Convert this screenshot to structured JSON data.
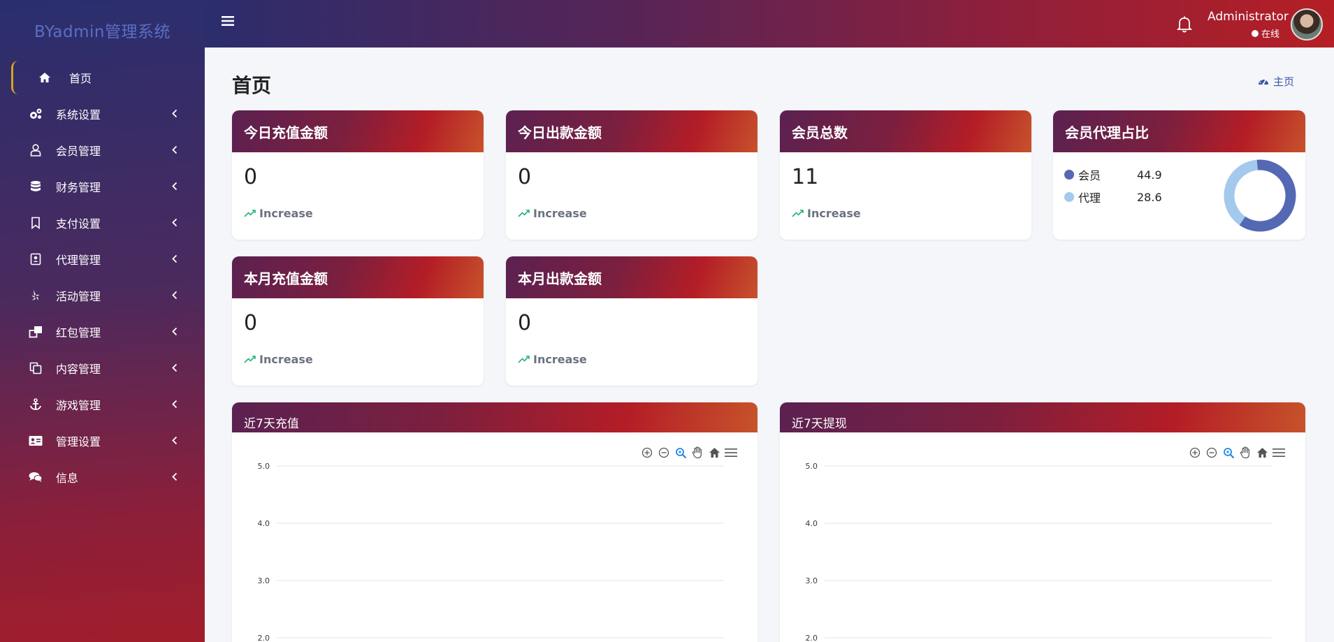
{
  "app": {
    "brand": "BYadmin管理系统"
  },
  "sidebar": {
    "items": [
      {
        "label": "首页",
        "icon": "home-icon",
        "active": true
      },
      {
        "label": "系统设置",
        "icon": "gears-icon"
      },
      {
        "label": "会员管理",
        "icon": "user-icon"
      },
      {
        "label": "财务管理",
        "icon": "database-icon"
      },
      {
        "label": "支付设置",
        "icon": "bookmark-icon"
      },
      {
        "label": "代理管理",
        "icon": "contact-card-icon"
      },
      {
        "label": "活动管理",
        "icon": "yelp-icon"
      },
      {
        "label": "红包管理",
        "icon": "clone-icon"
      },
      {
        "label": "内容管理",
        "icon": "copy-icon"
      },
      {
        "label": "游戏管理",
        "icon": "anchor-icon"
      },
      {
        "label": "管理设置",
        "icon": "id-card-icon"
      },
      {
        "label": "信息",
        "icon": "comments-icon"
      }
    ]
  },
  "topbar": {
    "user_name": "Administrator",
    "user_status": "在线"
  },
  "page": {
    "title": "首页",
    "breadcrumb": "主页"
  },
  "stats": [
    {
      "title": "今日充值金额",
      "value": "0",
      "trend": "Increase"
    },
    {
      "title": "今日出款金额",
      "value": "0",
      "trend": "Increase"
    },
    {
      "title": "会员总数",
      "value": "11",
      "trend": "Increase"
    },
    {
      "title": "本月充值金额",
      "value": "0",
      "trend": "Increase"
    },
    {
      "title": "本月出款金额",
      "value": "0",
      "trend": "Increase"
    }
  ],
  "ratio_card": {
    "title": "会员代理占比",
    "items": [
      {
        "label": "会员",
        "value": "44.9",
        "color": "#5468b4"
      },
      {
        "label": "代理",
        "value": "28.6",
        "color": "#a3c9ec"
      }
    ]
  },
  "colors": {
    "accent": "#d8a21e",
    "trend_up": "#22b573",
    "link": "#3b56a6"
  },
  "chart_data": [
    {
      "type": "line",
      "title": "近7天充值",
      "ylim": [
        2.0,
        5.0
      ],
      "y_ticks": [
        "5.0",
        "4.0",
        "3.0",
        "2.0"
      ],
      "grid": true,
      "series": []
    },
    {
      "type": "line",
      "title": "近7天提现",
      "ylim": [
        2.0,
        5.0
      ],
      "y_ticks": [
        "5.0",
        "4.0",
        "3.0",
        "2.0"
      ],
      "grid": true,
      "series": []
    }
  ]
}
